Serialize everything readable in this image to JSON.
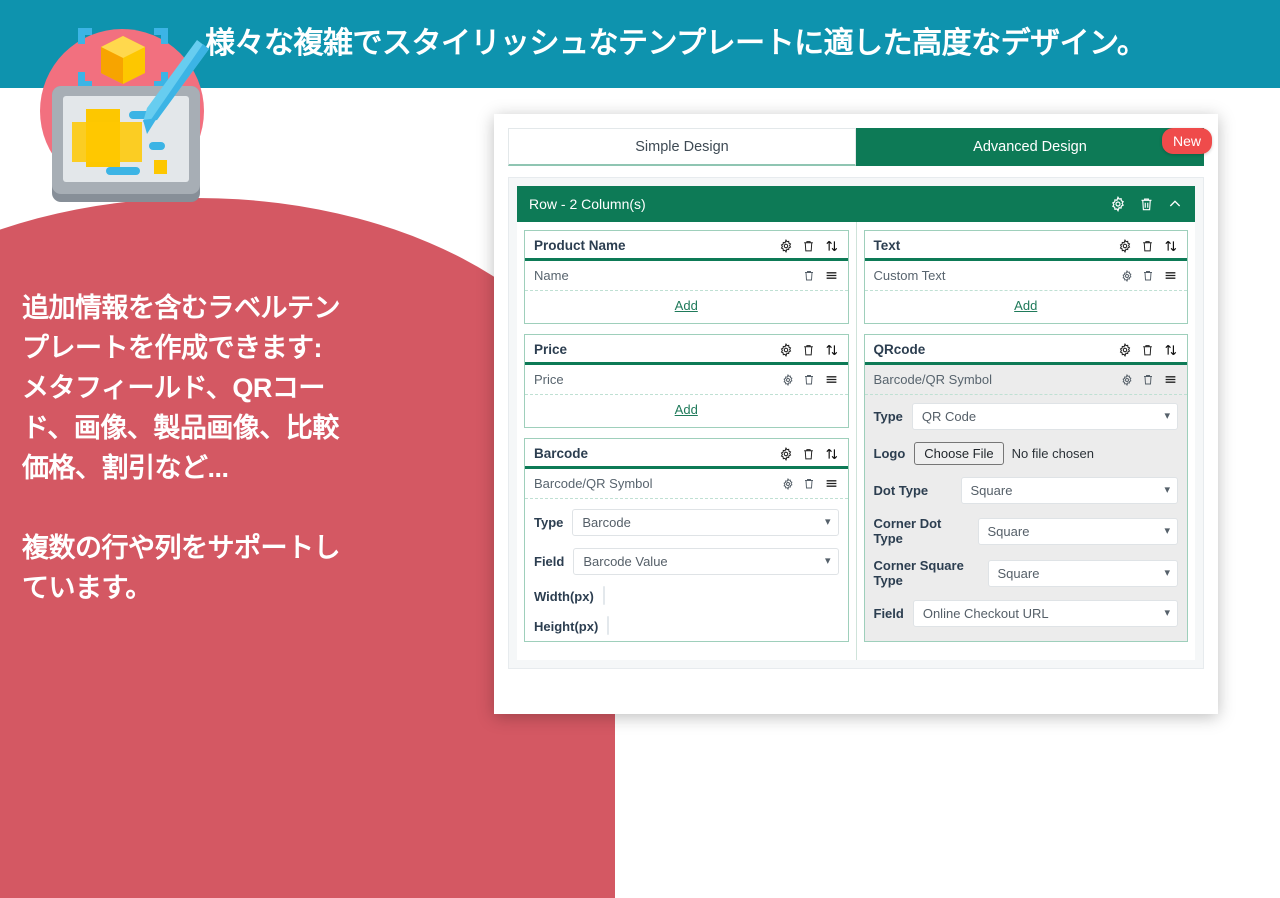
{
  "banner": {
    "title": "様々な複雑でスタイリッシュなテンプレートに適した高度なデザイン。",
    "bg_color": "#0e93ae",
    "text_color": "#ffffff"
  },
  "illustration": {
    "name": "design-tablet-illustration",
    "circle_color": "#f2707f",
    "tablet_color": "#8d949c",
    "accent_yellow": "#fdc700",
    "accent_blue": "#3cb4e5"
  },
  "blob": {
    "bg_color": "#d45863",
    "paragraphs": [
      "追加情報を含むラベルテン",
      "プレートを作成できます:",
      "メタフィールド、QRコー",
      "ド、画像、製品画像、比較",
      "価格、割引など..."
    ],
    "paragraphs2": [
      "複数の行や列をサポートし",
      "ています。"
    ]
  },
  "app": {
    "new_badge": "New",
    "accent_green": "#0d7a56",
    "badge_color": "#ef4b4b",
    "tabs": [
      {
        "label": "Simple Design",
        "active": false
      },
      {
        "label": "Advanced Design",
        "active": true
      }
    ],
    "row": {
      "title": "Row - 2 Column(s)",
      "icons": [
        "gear-icon",
        "trash-icon",
        "chevron-up-icon"
      ]
    },
    "left_column": {
      "cards": [
        {
          "title": "Product Name",
          "icons": [
            "gear-icon",
            "trash-icon",
            "sort-icon"
          ],
          "sub": {
            "label": "Name",
            "grey": false,
            "has_gear": false
          },
          "add_label": "Add"
        },
        {
          "title": "Price",
          "icons": [
            "gear-icon",
            "trash-icon",
            "sort-icon"
          ],
          "sub": {
            "label": "Price",
            "grey": false,
            "has_gear": true
          },
          "add_label": "Add"
        },
        {
          "title": "Barcode",
          "icons": [
            "gear-icon",
            "trash-icon",
            "sort-icon"
          ],
          "sub": {
            "label": "Barcode/QR Symbol",
            "grey": false,
            "has_gear": true
          },
          "fields": [
            {
              "label": "Type",
              "type": "select",
              "value": "Barcode"
            },
            {
              "label": "Field",
              "type": "select",
              "value": "Barcode Value"
            },
            {
              "label": "Width(px)",
              "type": "text",
              "value": ""
            },
            {
              "label": "Height(px)",
              "type": "text",
              "value": ""
            }
          ]
        }
      ]
    },
    "right_column": {
      "cards": [
        {
          "title": "Text",
          "icons": [
            "gear-icon",
            "trash-icon",
            "sort-icon"
          ],
          "sub": {
            "label": "Custom Text",
            "grey": false,
            "has_gear": true
          },
          "add_label": "Add"
        },
        {
          "title": "QRcode",
          "icons": [
            "gear-icon",
            "trash-icon",
            "sort-icon"
          ],
          "sub": {
            "label": "Barcode/QR Symbol",
            "grey": true,
            "has_gear": true
          },
          "fields": [
            {
              "label": "Type",
              "type": "select",
              "value": "QR Code"
            },
            {
              "label": "Logo",
              "type": "file",
              "button": "Choose File",
              "value": "No file chosen"
            },
            {
              "label": "Dot Type",
              "type": "select",
              "value": "Square"
            },
            {
              "label": "Corner Dot Type",
              "type": "select",
              "value": "Square"
            },
            {
              "label": "Corner Square Type",
              "type": "select",
              "value": "Square"
            },
            {
              "label": "Field",
              "type": "select",
              "value": "Online Checkout URL"
            }
          ]
        }
      ]
    }
  }
}
